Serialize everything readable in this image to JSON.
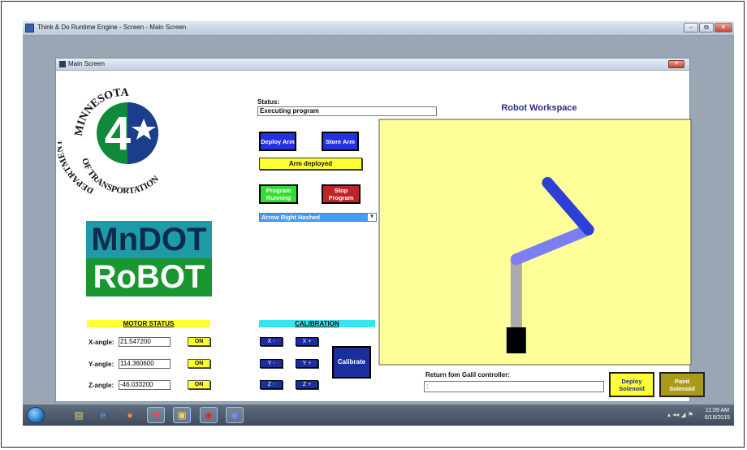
{
  "window": {
    "title": "Think & Do Runtime Engine - Screen - Main Screen",
    "minimize": "–",
    "restore": "⧉",
    "close": "✕"
  },
  "main": {
    "title": "Main Screen",
    "close": "✕",
    "logo": {
      "seal_top": "MINNESOTA",
      "seal_left": "DEPARTMENT",
      "seal_bottom": "OF TRANSPORTATION",
      "number": "4",
      "brand_line1": "MnDOT",
      "brand_line2": "RoBOT"
    },
    "status": {
      "label": "Status:",
      "value": "Executing program"
    },
    "buttons": {
      "deploy_arm": "Deploy Arm",
      "store_arm": "Store Arm",
      "arm_status": "Arm deployed",
      "program_running": "Program Running",
      "stop_program": "Stop Program",
      "pattern_selected": "Arrow Right Hashed",
      "dropdown": "▼"
    },
    "motor_status": {
      "header": "MOTOR STATUS",
      "on_label": "ON",
      "axes": [
        {
          "label": "X-angle:",
          "value": "21.547200"
        },
        {
          "label": "Y-angle:",
          "value": "114.360600"
        },
        {
          "label": "Z-angle:",
          "value": "-46.033200"
        }
      ]
    },
    "calibration": {
      "header": "CALIBRATION",
      "buttons": [
        "X -",
        "X +",
        "Y -",
        "Y +",
        "Z -",
        "Z +"
      ],
      "calibrate": "Calibrate"
    },
    "workspace": {
      "title": "Robot Workspace",
      "background": "#ffff99",
      "arm_segments": [
        {
          "color": "#aaaaaa",
          "from": [
            0.44,
            0.88
          ],
          "to": [
            0.44,
            0.57
          ]
        },
        {
          "color": "#7a7ef0",
          "from": [
            0.44,
            0.57
          ],
          "to": [
            0.67,
            0.45
          ]
        },
        {
          "color": "#2e3fd6",
          "from": [
            0.67,
            0.45
          ],
          "to": [
            0.54,
            0.26
          ]
        }
      ]
    },
    "galil": {
      "label": "Return fom Galil controller:",
      "value": ":"
    },
    "solenoid": {
      "deploy": "Deploy Solenoid",
      "paint": "Paint Solenoid"
    }
  },
  "taskbar": {
    "icons": [
      {
        "name": "explorer-icon",
        "glyph": "▤",
        "color": "#e8d27a"
      },
      {
        "name": "ie-icon",
        "glyph": "e",
        "color": "#4aa3ff"
      },
      {
        "name": "firefox-icon",
        "glyph": "●",
        "color": "#ff8a2a"
      },
      {
        "name": "app-icon-1",
        "glyph": "✚",
        "color": "#ff4040"
      },
      {
        "name": "app-icon-2",
        "glyph": "▣",
        "color": "#ffd24a"
      },
      {
        "name": "app-icon-3",
        "glyph": "◆",
        "color": "#d43030"
      },
      {
        "name": "app-icon-4",
        "glyph": "◆",
        "color": "#6a8cff"
      }
    ],
    "tray": "▴ ◂◂ ◢ ⚑",
    "time": "11:09 AM",
    "date": "6/19/2015"
  }
}
